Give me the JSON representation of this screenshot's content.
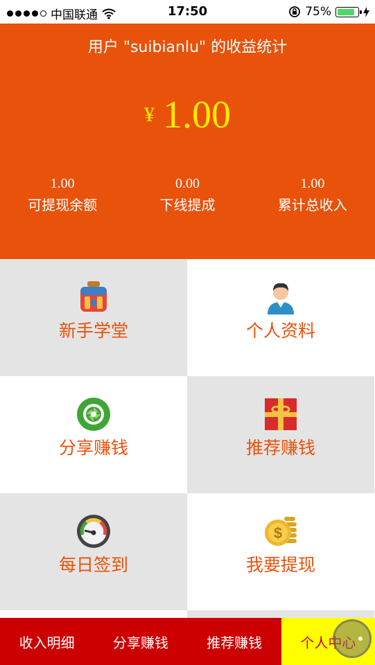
{
  "status_bar": {
    "carrier": "中国联通",
    "time": "17:50",
    "battery": "75%",
    "battery_level": 0.75
  },
  "header": {
    "title": "用户 \"suibianlu\" 的收益统计",
    "currency": "¥",
    "total": "1.00",
    "stats": [
      {
        "value": "1.00",
        "label": "可提现余额"
      },
      {
        "value": "0.00",
        "label": "下线提成"
      },
      {
        "value": "1.00",
        "label": "累计总收入"
      }
    ]
  },
  "menu": [
    {
      "label": "新手学堂",
      "icon": "backpack-icon"
    },
    {
      "label": "个人资料",
      "icon": "user-avatar-icon"
    },
    {
      "label": "分享赚钱",
      "icon": "share-lens-icon"
    },
    {
      "label": "推荐赚钱",
      "icon": "gift-box-icon"
    },
    {
      "label": "每日签到",
      "icon": "gauge-icon"
    },
    {
      "label": "我要提现",
      "icon": "coin-dollar-icon"
    }
  ],
  "bottom_nav": [
    {
      "label": "收入明细",
      "active": false
    },
    {
      "label": "分享赚钱",
      "active": false
    },
    {
      "label": "推荐赚钱",
      "active": false
    },
    {
      "label": "个人中心",
      "active": true
    }
  ],
  "colors": {
    "header_bg": "#e8520b",
    "amount": "#ffec00",
    "menu_text": "#e8520b",
    "nav_bg": "#cc0000",
    "nav_active": "#ffff00"
  }
}
